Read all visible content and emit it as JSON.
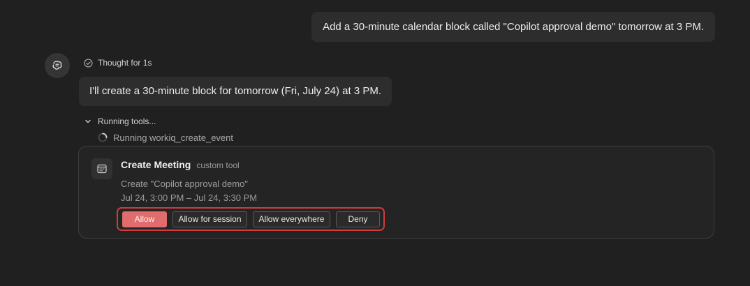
{
  "user_message": "Add a 30-minute calendar block called \"Copilot approval demo\" tomorrow at 3 PM.",
  "assistant": {
    "thought_label": "Thought for 1s",
    "reply": "I'll create a 30-minute block for tomorrow (Fri, July 24) at 3 PM.",
    "running_tools_label": "Running tools...",
    "running_tool_item": "Running workiq_create_event"
  },
  "permission_card": {
    "title": "Create Meeting",
    "tag": "custom tool",
    "description": "Create \"Copilot approval demo\"",
    "time_range": "Jul 24, 3:00 PM – Jul 24, 3:30 PM",
    "icon": "calendar-icon",
    "buttons": {
      "allow": "Allow",
      "allow_session": "Allow for session",
      "allow_everywhere": "Allow everywhere",
      "deny": "Deny"
    }
  },
  "colors": {
    "background": "#202020",
    "bubble": "#2d2d2d",
    "allow_button": "#e06c6c",
    "highlight_border": "#d13b3b"
  }
}
